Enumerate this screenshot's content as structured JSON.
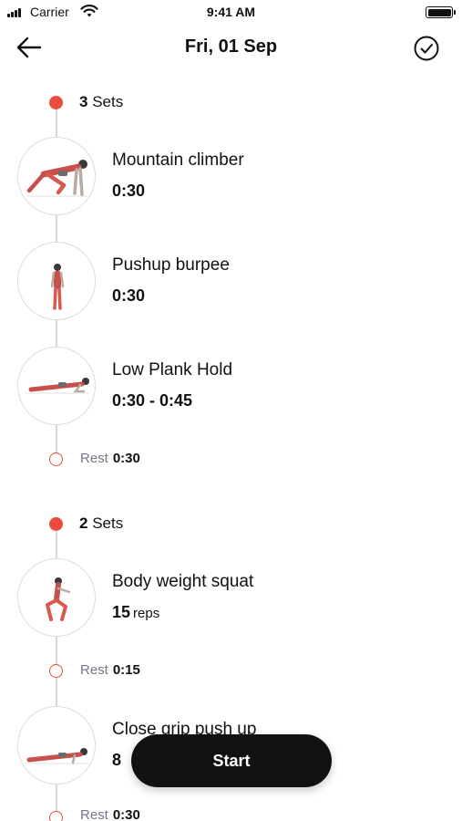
{
  "status_bar": {
    "carrier": "Carrier",
    "time": "9:41 AM"
  },
  "nav": {
    "title": "Fri, 01 Sep",
    "back_icon": "arrow-left-icon",
    "done_icon": "check-circle-icon"
  },
  "groups": [
    {
      "sets_count": "3",
      "sets_word": "Sets",
      "exercises": [
        {
          "name": "Mountain climber",
          "value": "0:30",
          "unit": ""
        },
        {
          "name": "Pushup burpee",
          "value": "0:30",
          "unit": ""
        },
        {
          "name": "Low Plank Hold",
          "value": "0:30 - 0:45",
          "unit": ""
        }
      ],
      "rest": {
        "label": "Rest",
        "time": "0:30"
      }
    },
    {
      "sets_count": "2",
      "sets_word": "Sets",
      "exercises": [
        {
          "name": "Body weight squat",
          "value": "15",
          "unit": "reps"
        },
        {
          "name": "Close grip push up",
          "value": "8",
          "unit": ""
        }
      ],
      "rests": [
        {
          "label": "Rest",
          "time": "0:15"
        },
        {
          "label": "Rest",
          "time": "0:30"
        }
      ]
    }
  ],
  "start_label": "Start",
  "colors": {
    "accent": "#ea4d3d",
    "primary": "#111111",
    "rest_text": "#74798a"
  }
}
